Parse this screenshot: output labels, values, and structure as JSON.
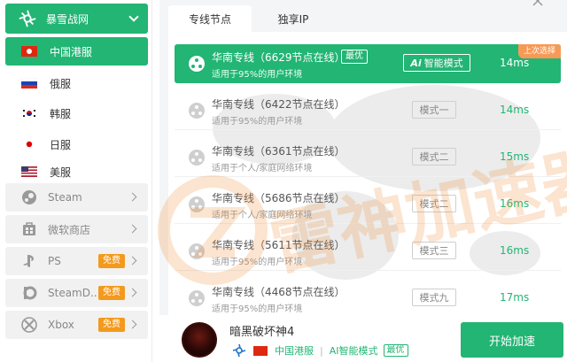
{
  "sidebar": {
    "network_name": "暴雪战网",
    "regions": [
      {
        "label": "中国港服",
        "flag": "hk-flag-icon",
        "active": true
      },
      {
        "label": "俄服",
        "flag": "ru-flag-icon",
        "active": false
      },
      {
        "label": "韩服",
        "flag": "kr-flag-icon",
        "active": false
      },
      {
        "label": "日服",
        "flag": "jp-flag-icon",
        "active": false
      },
      {
        "label": "美服",
        "flag": "us-flag-icon",
        "active": false
      }
    ],
    "platforms": [
      {
        "label": "Steam",
        "icon": "steam-icon",
        "badge": ""
      },
      {
        "label": "微软商店",
        "icon": "microsoft-store-icon",
        "badge": ""
      },
      {
        "label": "PS",
        "icon": "playstation-icon",
        "badge": "免费"
      },
      {
        "label": "SteamD...",
        "icon": "steam-deck-icon",
        "badge": "免费"
      },
      {
        "label": "Xbox",
        "icon": "xbox-icon",
        "badge": "免费"
      }
    ]
  },
  "tabs": [
    {
      "label": "专线节点",
      "active": true
    },
    {
      "label": "独享IP",
      "active": false
    }
  ],
  "nodes": [
    {
      "title": "华南专线（6629节点在线）",
      "subtitle": "适用于95%的用户环境",
      "best": "最优",
      "mode": "智能模式",
      "mode_prefix": "Ai",
      "latency": "14ms",
      "selected": true,
      "tag": "上次选择"
    },
    {
      "title": "华南专线（6422节点在线）",
      "subtitle": "适用于95%的用户环境",
      "mode": "模式一",
      "latency": "14ms"
    },
    {
      "title": "华南专线（6361节点在线）",
      "subtitle": "适用于个人/家庭网络环境",
      "mode": "模式二",
      "latency": "15ms"
    },
    {
      "title": "华南专线（5686节点在线）",
      "subtitle": "适用于个人/家庭网络环境",
      "mode": "模式二",
      "latency": "16ms"
    },
    {
      "title": "华南专线（5611节点在线）",
      "subtitle": "适用于95%的用户环境",
      "mode": "模式三",
      "latency": "16ms"
    },
    {
      "title": "华南专线（4468节点在线）",
      "subtitle": "适用于95%的用户环境",
      "mode": "模式九",
      "latency": "17ms"
    }
  ],
  "footer": {
    "game_title": "暗黑破坏神4",
    "region": "中国港服",
    "mode": "AI智能模式",
    "best": "最优",
    "start_button": "开始加速"
  },
  "watermark": "雷神加速器",
  "colors": {
    "accent": "#22b574",
    "badge": "#f39a1e",
    "last_tag": "#f79a57"
  }
}
